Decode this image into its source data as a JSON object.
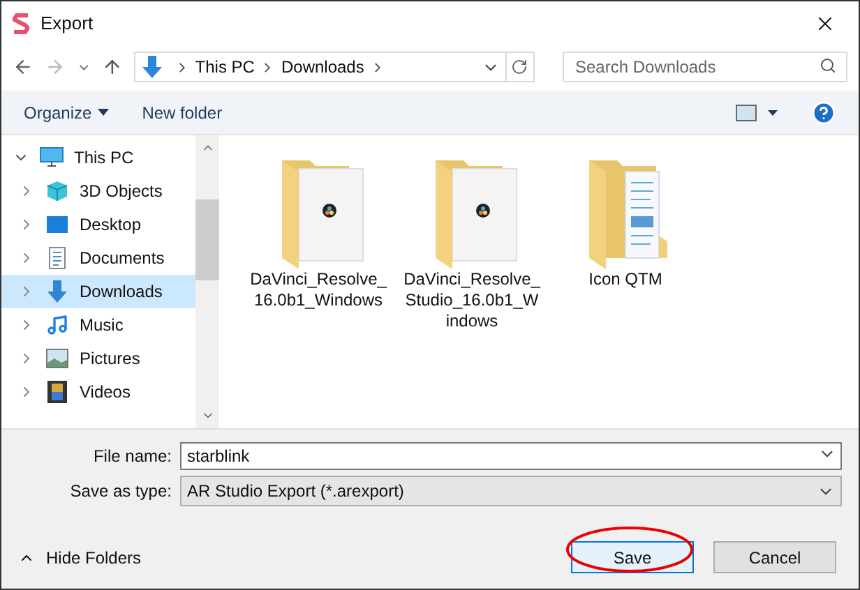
{
  "window": {
    "title": "Export"
  },
  "address": {
    "crumbs": [
      "This PC",
      "Downloads"
    ]
  },
  "search": {
    "placeholder": "Search Downloads"
  },
  "toolbar": {
    "organize": "Organize",
    "new_folder": "New folder"
  },
  "sidebar": {
    "items": [
      {
        "label": "This PC",
        "kind": "pc",
        "expanded": true,
        "selected": false,
        "children": [
          {
            "label": "3D Objects",
            "kind": "cube",
            "expanded": false,
            "selected": false
          },
          {
            "label": "Desktop",
            "kind": "desktop",
            "expanded": false,
            "selected": false
          },
          {
            "label": "Documents",
            "kind": "document",
            "expanded": false,
            "selected": false
          },
          {
            "label": "Downloads",
            "kind": "download",
            "expanded": false,
            "selected": true
          },
          {
            "label": "Music",
            "kind": "music",
            "expanded": false,
            "selected": false
          },
          {
            "label": "Pictures",
            "kind": "pictures",
            "expanded": false,
            "selected": false
          },
          {
            "label": "Videos",
            "kind": "video",
            "expanded": false,
            "selected": false
          }
        ]
      }
    ]
  },
  "files": [
    {
      "name": "DaVinci_Resolve_16.0b1_Windows",
      "kind": "app"
    },
    {
      "name": "DaVinci_Resolve_Studio_16.0b1_Windows",
      "kind": "app"
    },
    {
      "name": "Icon QTM",
      "kind": "documents"
    }
  ],
  "file_name": {
    "label": "File name:",
    "value": "starblink"
  },
  "save_type": {
    "label": "Save as type:",
    "value": "AR Studio Export (*.arexport)"
  },
  "hide_folders": "Hide Folders",
  "buttons": {
    "save": "Save",
    "cancel": "Cancel"
  }
}
